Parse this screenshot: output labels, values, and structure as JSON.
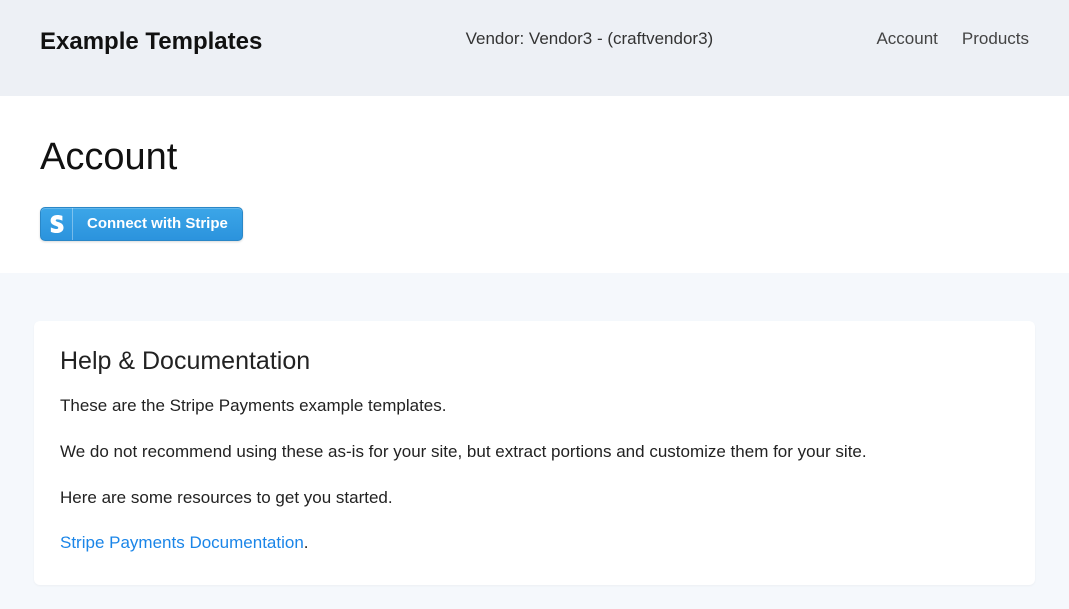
{
  "header": {
    "brand": "Example Templates",
    "vendor_info": "Vendor: Vendor3 - (craftvendor3)",
    "nav": {
      "account": "Account",
      "products": "Products"
    }
  },
  "main": {
    "title": "Account",
    "connect_button": "Connect with Stripe"
  },
  "help": {
    "title": "Help & Documentation",
    "p1": "These are the Stripe Payments example templates.",
    "p2": "We do not recommend using these as-is for your site, but extract portions and customize them for your site.",
    "p3": "Here are some resources to get you started.",
    "link_text": "Stripe Payments Documentation",
    "link_suffix": "."
  }
}
